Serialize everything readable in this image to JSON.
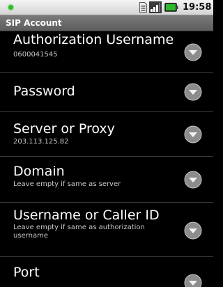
{
  "status_bar": {
    "time": "19:58",
    "icons": [
      "notification-dot-icon",
      "sim-card-icon",
      "signal-strength-icon",
      "battery-icon"
    ],
    "colors": {
      "notification": "#26c426",
      "battery": "#2dbb2d"
    }
  },
  "title_bar": {
    "title": "SIP Account"
  },
  "preferences": [
    {
      "title": "Authorization Username",
      "summary": "0600041545",
      "icon": "chevron-down-icon"
    },
    {
      "title": "Password",
      "summary": "",
      "icon": "chevron-down-icon"
    },
    {
      "title": "Server or Proxy",
      "summary": "203.113.125.82",
      "icon": "chevron-down-icon"
    },
    {
      "title": "Domain",
      "summary": "Leave empty if same as server",
      "icon": "chevron-down-icon"
    },
    {
      "title": "Username or Caller ID",
      "summary": "Leave empty if same as authorization username",
      "icon": "chevron-down-icon"
    },
    {
      "title": "Port",
      "summary": "",
      "icon": "chevron-down-icon"
    }
  ]
}
